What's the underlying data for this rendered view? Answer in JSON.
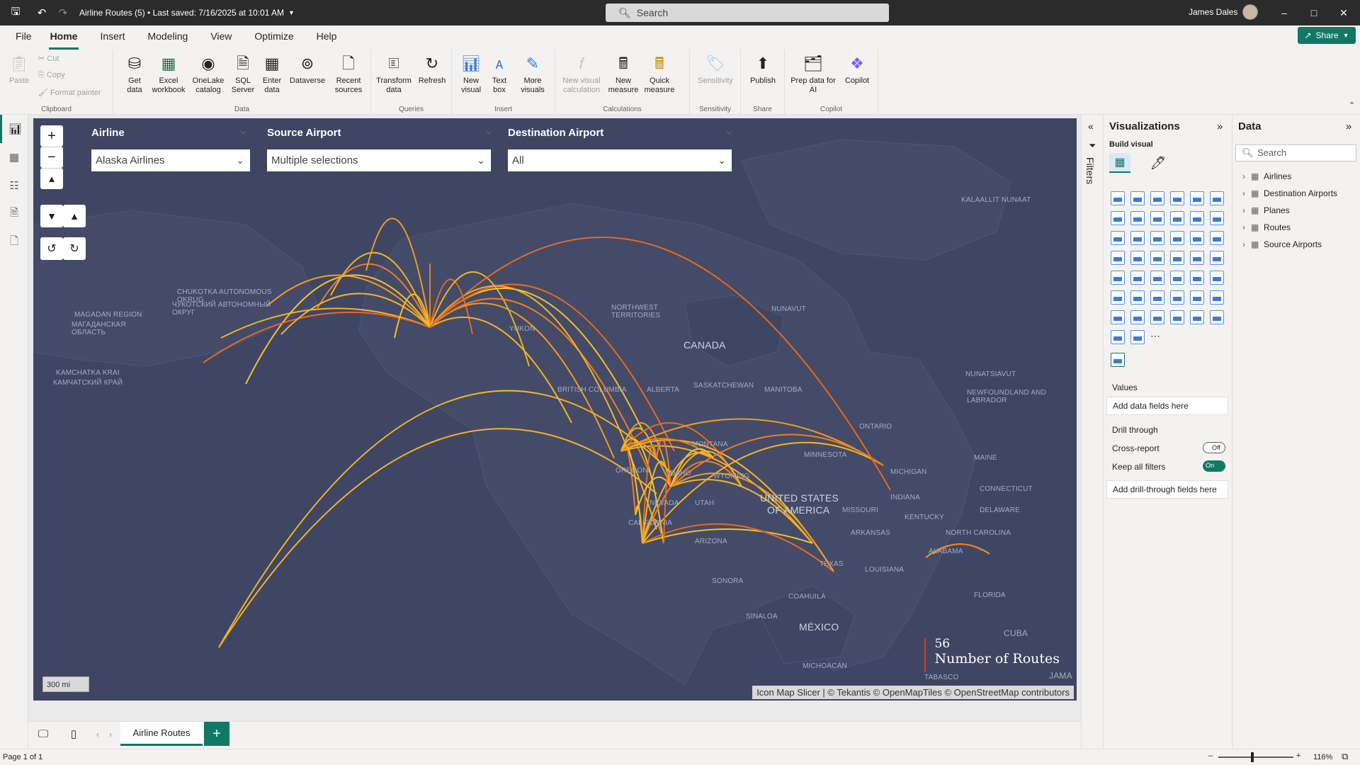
{
  "titlebar": {
    "title": "Airline Routes (5) • Last saved: 7/16/2025 at 10:01 AM",
    "search_placeholder": "Search",
    "user": "James Dales"
  },
  "menu": [
    "File",
    "Home",
    "Insert",
    "Modeling",
    "View",
    "Optimize",
    "Help"
  ],
  "share_label": "Share",
  "ribbon": {
    "clipboard": {
      "paste": "Paste",
      "cut": "Cut",
      "copy": "Copy",
      "format_painter": "Format painter",
      "group": "Clipboard"
    },
    "data": {
      "get_data": "Get data",
      "excel": "Excel workbook",
      "onelake": "OneLake catalog",
      "sql": "SQL Server",
      "enter_data": "Enter data",
      "dataverse": "Dataverse",
      "recent": "Recent sources",
      "group": "Data"
    },
    "queries": {
      "transform": "Transform data",
      "refresh": "Refresh",
      "group": "Queries"
    },
    "insert": {
      "new_visual": "New visual",
      "text_box": "Text box",
      "more_visuals": "More visuals",
      "group": "Insert"
    },
    "calculations": {
      "new_visual_calc": "New visual calculation",
      "new_measure": "New measure",
      "quick_measure": "Quick measure",
      "group": "Calculations"
    },
    "sensitivity": {
      "label": "Sensitivity",
      "group": "Sensitivity"
    },
    "share": {
      "publish": "Publish",
      "group": "Share"
    },
    "copilot": {
      "prep": "Prep data for AI",
      "copilot": "Copilot",
      "group": "Copilot"
    }
  },
  "slicers": {
    "airline": {
      "title": "Airline",
      "value": "Alaska Airlines"
    },
    "source": {
      "title": "Source Airport",
      "value": "Multiple selections"
    },
    "destination": {
      "title": "Destination Airport",
      "value": "All"
    }
  },
  "map": {
    "labels": [
      "KALAALLIT NUNAAT",
      "CHUKOTKA AUTONOMOUS OKRUG",
      "ЧУКОТСКИЙ АВТОНОМНЫЙ ОКРУГ",
      "MAGADAN REGION",
      "МАГАДАНСКАЯ ОБЛАСТЬ",
      "KAMCHATKA KRAI",
      "КАМЧАТСКИЙ КРАЙ",
      "NORTHWEST TERRITORIES",
      "NUNAVUT",
      "CANADA",
      "YUKON",
      "BRITISH COLUMBIA",
      "ALBERTA",
      "SASKATCHEWAN",
      "MANITOBA",
      "NUNATSIAVUT",
      "NEWFOUNDLAND AND LABRADOR",
      "ONTARIO",
      "MINNESOTA",
      "MICHIGAN",
      "MAINE",
      "MONTANA",
      "IDAHO",
      "WYOMING",
      "OREGON",
      "NEVADA",
      "UTAH",
      "UNITED STATES",
      "OF AMERICA",
      "MISSOURI",
      "INDIANA",
      "CONNECTICUT",
      "KENTUCKY",
      "DELAWARE",
      "CALIFORNIA",
      "ARIZONA",
      "ARKANSAS",
      "NORTH CAROLINA",
      "ALABAMA",
      "TEXAS",
      "LOUISIANA",
      "SONORA",
      "COAHUILA",
      "FLORIDA",
      "SINALOA",
      "MÉXICO",
      "MICHOACÁN",
      "CUBA",
      "TABASCO",
      "JAMA"
    ],
    "legend_value": "56",
    "legend_title": "Number of Routes",
    "scale": "300 mi",
    "attribution": "Icon Map Slicer | © Tekantis © OpenMapTiles © OpenStreetMap contributors"
  },
  "page_tab": "Airline Routes",
  "status": {
    "page": "Page 1 of 1",
    "zoom": "116%"
  },
  "filters_label": "Filters",
  "viz": {
    "title": "Visualizations",
    "build_visual": "Build visual",
    "values": "Values",
    "add_data": "Add data fields here",
    "drill_through": "Drill through",
    "cross_report": "Cross-report",
    "cross_report_state": "Off",
    "keep_filters": "Keep all filters",
    "keep_filters_state": "On",
    "add_drill": "Add drill-through fields here"
  },
  "data_pane": {
    "title": "Data",
    "search_placeholder": "Search",
    "tables": [
      "Airlines",
      "Destination Airports",
      "Planes",
      "Routes",
      "Source Airports"
    ]
  },
  "colors": {
    "accent": "#117865",
    "map_bg": "#3e4663",
    "route_hi": "#e0322c",
    "route_lo": "#f2b225"
  }
}
